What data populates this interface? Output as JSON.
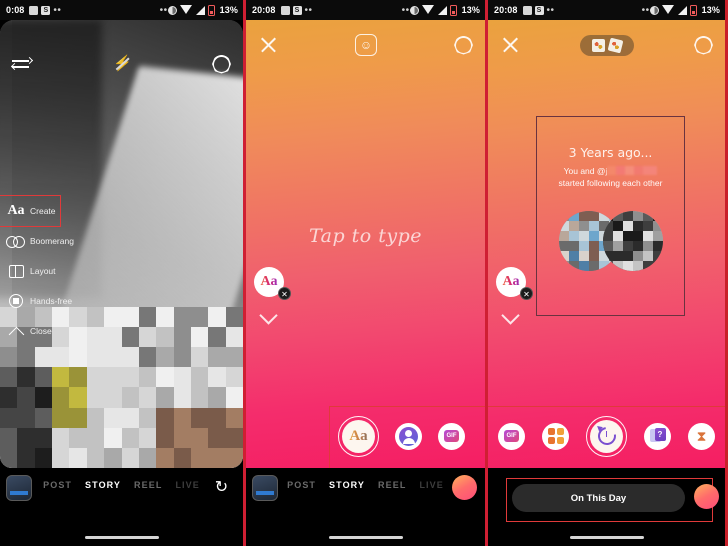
{
  "panels": [
    {
      "id": "camera",
      "status": {
        "time": "0:08",
        "battery": "13%",
        "dots": "••",
        "center_dots": "••"
      },
      "top_icons": {
        "switch": "switch-camera-icon",
        "flash": "flash-off-icon",
        "settings": "settings-icon"
      },
      "menu": {
        "items": [
          {
            "label": "Create",
            "icon": "aa-icon",
            "selected": true
          },
          {
            "label": "Boomerang",
            "icon": "boomerang-icon",
            "selected": false
          },
          {
            "label": "Layout",
            "icon": "layout-icon",
            "selected": false
          },
          {
            "label": "Hands-free",
            "icon": "hands-free-icon",
            "selected": false
          },
          {
            "label": "Close",
            "icon": "chevron-up-icon",
            "selected": false
          }
        ]
      },
      "modes": [
        {
          "label": "POST",
          "state": "inactive"
        },
        {
          "label": "STORY",
          "state": "active"
        },
        {
          "label": "REEL",
          "state": "inactive"
        },
        {
          "label": "LIVE",
          "state": "dim"
        }
      ],
      "flip_icon": "↻"
    },
    {
      "id": "story-text",
      "status": {
        "time": "20:08",
        "battery": "13%",
        "dots": "••",
        "center_dots": "••"
      },
      "top_icons": {
        "close": "close-icon",
        "sticker": "sticker-icon",
        "settings": "settings-icon"
      },
      "canvas_hint": "Tap to type",
      "float": {
        "label": "Aa",
        "badge": "✕",
        "chevron": "chevron-down-icon"
      },
      "tools": [
        {
          "name": "text-tool",
          "label": "Aa",
          "selected": true
        },
        {
          "name": "avatar-tool",
          "label": "",
          "selected": false
        },
        {
          "name": "gif-tool",
          "label": "GIF",
          "selected": false
        }
      ],
      "modes": [
        {
          "label": "POST",
          "state": "inactive"
        },
        {
          "label": "STORY",
          "state": "active"
        },
        {
          "label": "REEL",
          "state": "inactive"
        },
        {
          "label": "LIVE",
          "state": "dim"
        }
      ]
    },
    {
      "id": "story-on-this-day",
      "status": {
        "time": "20:08",
        "battery": "13%",
        "dots": "••",
        "center_dots": "••"
      },
      "top_icons": {
        "close": "close-icon",
        "cards": "memory-cards-pill",
        "settings": "settings-icon"
      },
      "memory": {
        "title": "3 Years ago...",
        "line1_prefix": "You and @j",
        "line2": "started following each other"
      },
      "float": {
        "label": "Aa",
        "badge": "✕",
        "chevron": "chevron-down-icon"
      },
      "tools": [
        {
          "name": "gif-tool",
          "label": "GIF",
          "selected": false
        },
        {
          "name": "templates-tool",
          "label": "",
          "selected": false
        },
        {
          "name": "on-this-day-tool",
          "label": "",
          "selected": true
        },
        {
          "name": "quiz-tool",
          "label": "?",
          "selected": false
        },
        {
          "name": "countdown-tool",
          "label": "⧗",
          "selected": false
        }
      ],
      "action_button": "On This Day"
    }
  ],
  "colors": {
    "selection_red": "#e03a3a",
    "divider_red": "#cf1f33",
    "accent_pink": "#f51e62",
    "accent_orange": "#eaa23e",
    "status_bg": "#0b0b0b"
  }
}
